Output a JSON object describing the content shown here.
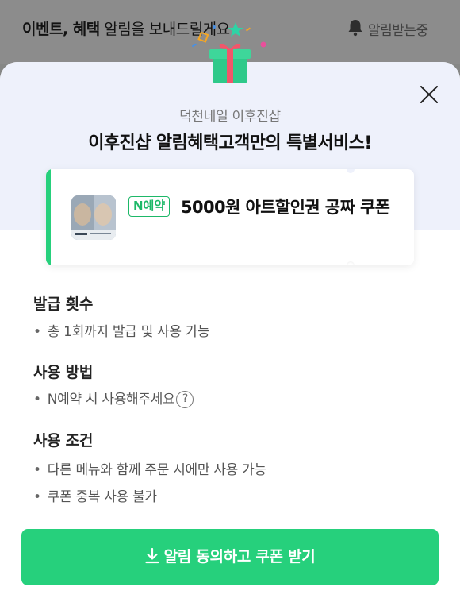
{
  "background": {
    "title_bold": "이벤트, 혜택",
    "title_rest": " 알림을 보내드릴게요",
    "notify_label": "알림받는중"
  },
  "sheet": {
    "store_name": "덕천네일 이후진샵",
    "title": "이후진샵 알림혜택고객만의 특별서비스!"
  },
  "coupon": {
    "badge": "N예약",
    "text": "5000원 아트할인권 공짜 쿠폰"
  },
  "sections": [
    {
      "heading": "발급 횟수",
      "items": [
        "총 1회까지 발급 및 사용 가능"
      ]
    },
    {
      "heading": "사용 방법",
      "items": [
        "N예약 시 사용해주세요"
      ]
    },
    {
      "heading": "사용 조건",
      "items": [
        "다른 메뉴와 함께 주문 시에만 사용 가능",
        "쿠폰 중복 사용 불가"
      ]
    }
  ],
  "help_icon_glyph": "?",
  "cta_label": "알림 동의하고 쿠폰 받기",
  "colors": {
    "accent_green": "#26d07c",
    "sheet_top_bg": "#eef1fb",
    "gift_box": "#3ed69a",
    "gift_ribbon": "#f2566a"
  }
}
